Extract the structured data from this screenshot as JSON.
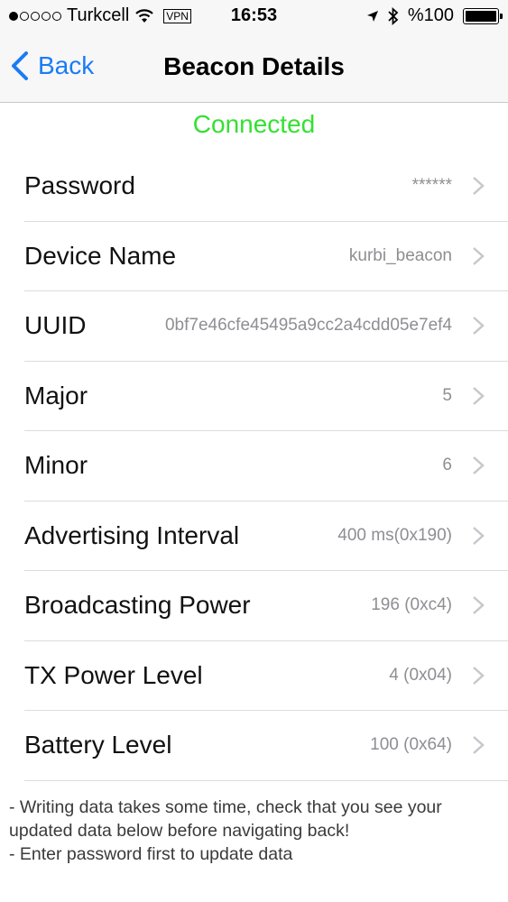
{
  "status_bar": {
    "carrier": "Turkcell",
    "vpn": "VPN",
    "time": "16:53",
    "battery": "%100",
    "icons": [
      "signal-dots",
      "wifi-icon",
      "location-arrow-icon",
      "bluetooth-icon",
      "battery-icon"
    ]
  },
  "nav": {
    "back_label": "Back",
    "title": "Beacon Details"
  },
  "connection": {
    "status": "Connected",
    "color": "#35e032"
  },
  "rows": [
    {
      "label": "Password",
      "value": "******"
    },
    {
      "label": "Device Name",
      "value": "kurbi_beacon"
    },
    {
      "label": "UUID",
      "value": "0bf7e46cfe45495a9cc2a4cdd05e7ef4"
    },
    {
      "label": "Major",
      "value": "5"
    },
    {
      "label": "Minor",
      "value": "6"
    },
    {
      "label": "Advertising Interval",
      "value": "400 ms(0x190)"
    },
    {
      "label": "Broadcasting Power",
      "value": "196 (0xc4)"
    },
    {
      "label": "TX Power Level",
      "value": "4 (0x04)"
    },
    {
      "label": "Battery Level",
      "value": "100 (0x64)"
    }
  ],
  "notes": [
    "- Writing data takes some time, check that you see your updated data below before navigating back!",
    "- Enter password first to update data"
  ],
  "colors": {
    "accent": "#1a7cf5",
    "value_gray": "#8e8e93"
  }
}
